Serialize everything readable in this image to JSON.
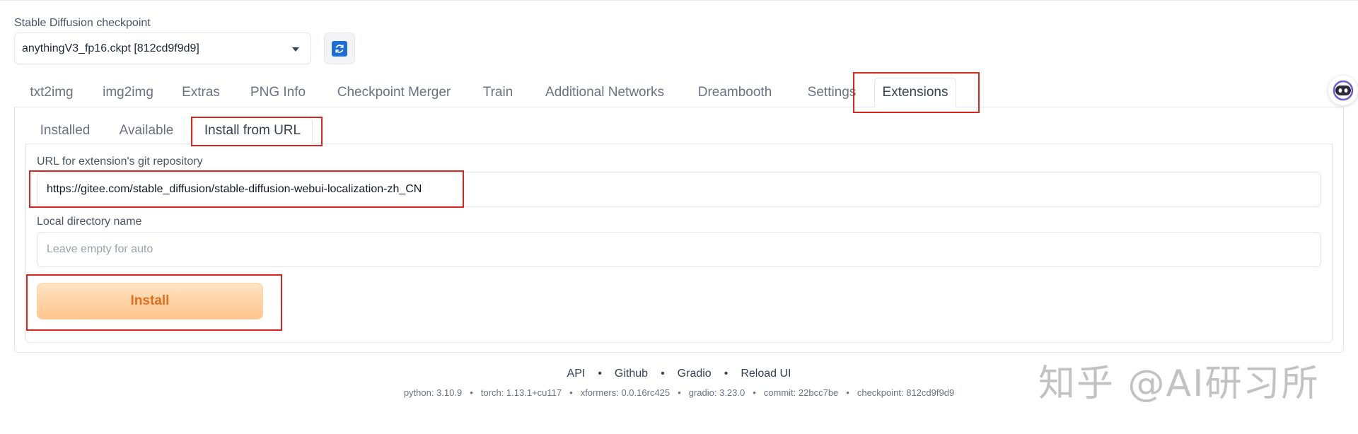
{
  "checkpoint": {
    "label": "Stable Diffusion checkpoint",
    "selected": "anythingV3_fp16.ckpt [812cd9f9d9]",
    "refresh_icon": "refresh-icon"
  },
  "main_tabs": [
    {
      "label": "txt2img",
      "active": false
    },
    {
      "label": "img2img",
      "active": false
    },
    {
      "label": "Extras",
      "active": false
    },
    {
      "label": "PNG Info",
      "active": false
    },
    {
      "label": "Checkpoint Merger",
      "active": false
    },
    {
      "label": "Train",
      "active": false
    },
    {
      "label": "Additional Networks",
      "active": false
    },
    {
      "label": "Dreambooth",
      "active": false
    },
    {
      "label": "Settings",
      "active": false
    },
    {
      "label": "Extensions",
      "active": true
    }
  ],
  "sub_tabs": [
    {
      "label": "Installed",
      "active": false
    },
    {
      "label": "Available",
      "active": false
    },
    {
      "label": "Install from URL",
      "active": true
    }
  ],
  "install_form": {
    "url_label": "URL for extension's git repository",
    "url_value": "https://gitee.com/stable_diffusion/stable-diffusion-webui-localization-zh_CN",
    "dir_label": "Local directory name",
    "dir_placeholder": "Leave empty for auto",
    "install_label": "Install"
  },
  "footer": {
    "links": [
      "API",
      "Github",
      "Gradio",
      "Reload UI"
    ],
    "separator": "•",
    "info": [
      "python: 3.10.9",
      "torch: 1.13.1+cu117",
      "xformers: 0.0.16rc425",
      "gradio: 3.23.0",
      "commit: 22bcc7be",
      "checkpoint: 812cd9f9d9"
    ]
  },
  "watermark": "知乎 @AI研习所",
  "colors": {
    "highlight": "#d7261e",
    "install_text": "#e2701c",
    "refresh_icon": "#1d6fd6"
  }
}
